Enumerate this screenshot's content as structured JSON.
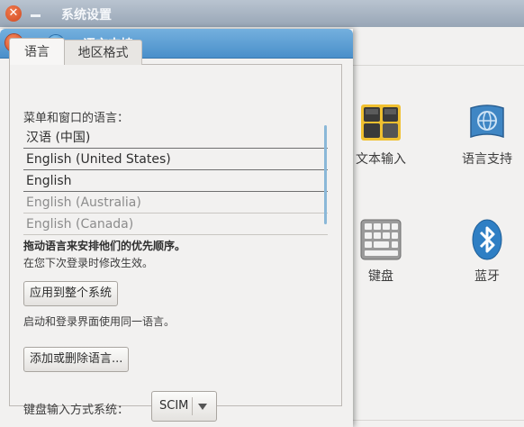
{
  "background_window": {
    "title": "系统设置",
    "items": [
      {
        "label": "文本输入",
        "icon": "text-entry-icon"
      },
      {
        "label": "语言支持",
        "icon": "language-support-icon"
      },
      {
        "label": "键盘",
        "icon": "keyboard-icon"
      },
      {
        "label": "蓝牙",
        "icon": "bluetooth-icon"
      }
    ]
  },
  "dialog": {
    "title": "语言支持",
    "tabs": [
      {
        "label": "语言",
        "active": true
      },
      {
        "label": "地区格式",
        "active": false
      }
    ],
    "menu_language_label": "菜单和窗口的语言：",
    "languages": [
      {
        "label": "汉语 (中国)",
        "enabled": true
      },
      {
        "label": "English (United States)",
        "enabled": true
      },
      {
        "label": "English",
        "enabled": true
      },
      {
        "label": "English (Australia)",
        "enabled": false
      },
      {
        "label": "English (Canada)",
        "enabled": false
      }
    ],
    "drag_hint": "拖动语言来安排他们的优先顺序。",
    "next_login_hint": "在您下次登录时修改生效。",
    "apply_button": "应用到整个系统",
    "apply_hint": "启动和登录界面使用同一语言。",
    "add_remove_button": "添加或删除语言...",
    "input_method_label": "键盘输入方式系统：",
    "input_method_value": "SCIM"
  },
  "colors": {
    "title_active": "#4a8fca",
    "close_button": "#d9481d",
    "scroll_indicator": "#8ab8d8"
  }
}
